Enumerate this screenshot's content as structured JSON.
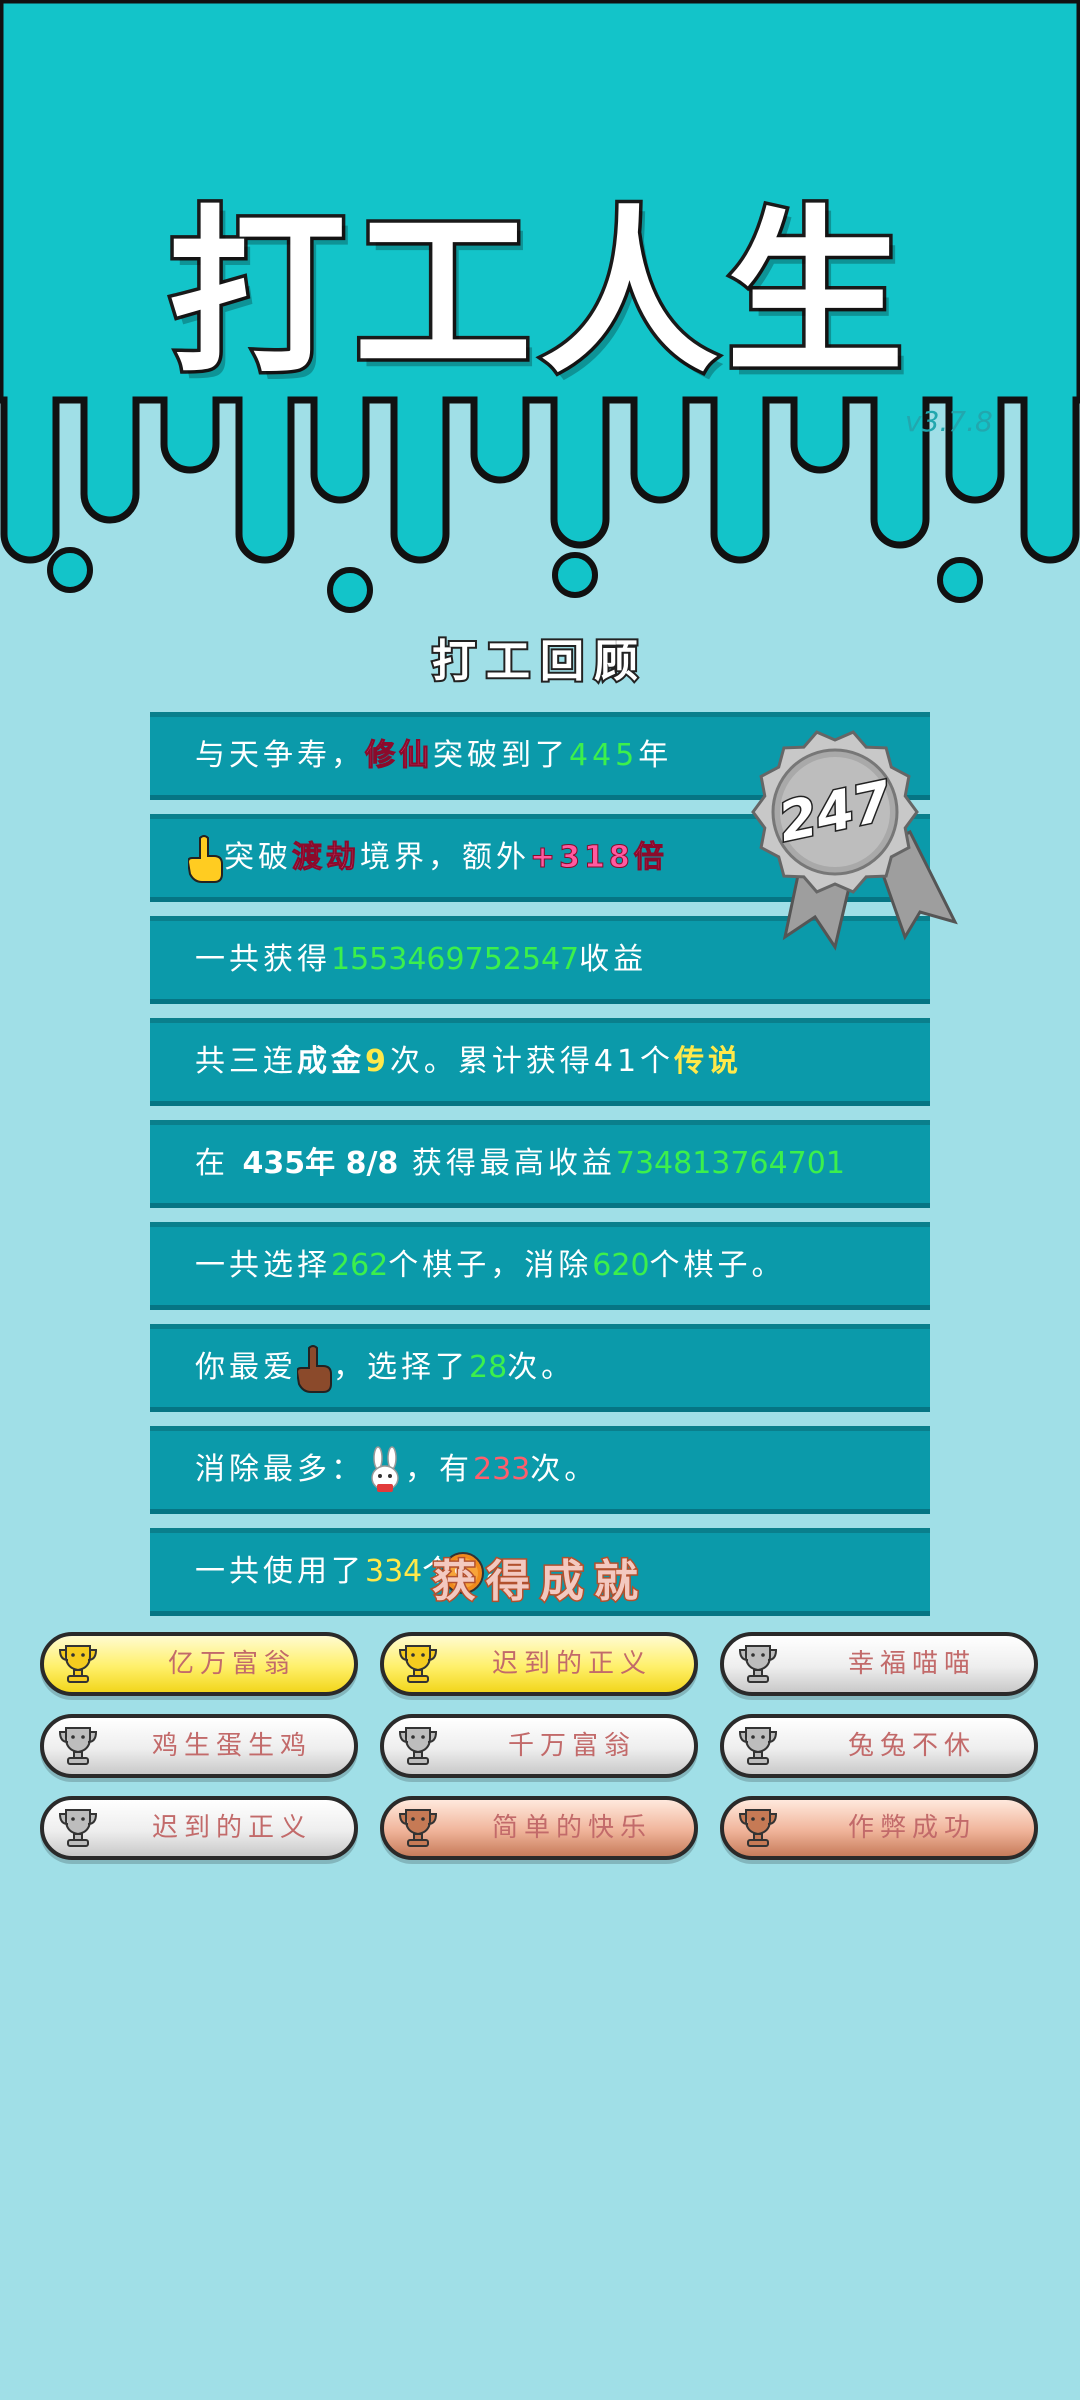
{
  "header": {
    "title": "打工人生",
    "version": "v3.7.8"
  },
  "review": {
    "heading": "打工回顾",
    "medal_number": "247",
    "rows": [
      {
        "pre": "与天争寿，",
        "hl1": "修仙",
        "mid": "突破到了",
        "num": "445",
        "post": "年"
      },
      {
        "pre": "突破",
        "hl1": "渡劫",
        "mid": "境界，额外",
        "num": "+318倍",
        "post": ""
      },
      {
        "pre": "一共获得",
        "num": "1553469752547",
        "post": "收益"
      },
      {
        "pre": "共三连",
        "bold1": "成金",
        "num": "9",
        "mid": "次。累计获得41个",
        "hl1": "传说"
      },
      {
        "pre": "在 ",
        "bold1": "435年 8/8",
        "mid": " 获得最高收益",
        "num": "734813764701"
      },
      {
        "pre": "一共选择",
        "num": "262",
        "mid": "个棋子，消除",
        "num2": "620",
        "post": "个棋子。"
      },
      {
        "pre": "你最爱",
        "mid": "，选择了",
        "num": "28",
        "post": "次。"
      },
      {
        "pre": "消除最多：",
        "mid": "，有",
        "num": "233",
        "post": "次。"
      },
      {
        "pre": "一共使用了",
        "num": "334",
        "mid": "个",
        "post": "。"
      }
    ]
  },
  "achievements": {
    "heading": "获得成就",
    "badges": [
      {
        "label": "亿万富翁",
        "tier": "gold"
      },
      {
        "label": "迟到的正义",
        "tier": "gold"
      },
      {
        "label": "幸福喵喵",
        "tier": "silver"
      },
      {
        "label": "鸡生蛋生鸡",
        "tier": "silver"
      },
      {
        "label": "千万富翁",
        "tier": "silver"
      },
      {
        "label": "兔兔不休",
        "tier": "silver"
      },
      {
        "label": "迟到的正义",
        "tier": "silver"
      },
      {
        "label": "简单的快乐",
        "tier": "bronze"
      },
      {
        "label": "作弊成功",
        "tier": "bronze"
      }
    ]
  },
  "colors": {
    "top_bg": "#13c4c9",
    "page_bg": "#a0dfe7",
    "row_bg": "#0b9aaa",
    "highlight_green": "#3cf04c",
    "highlight_yellow": "#ffe94a"
  }
}
